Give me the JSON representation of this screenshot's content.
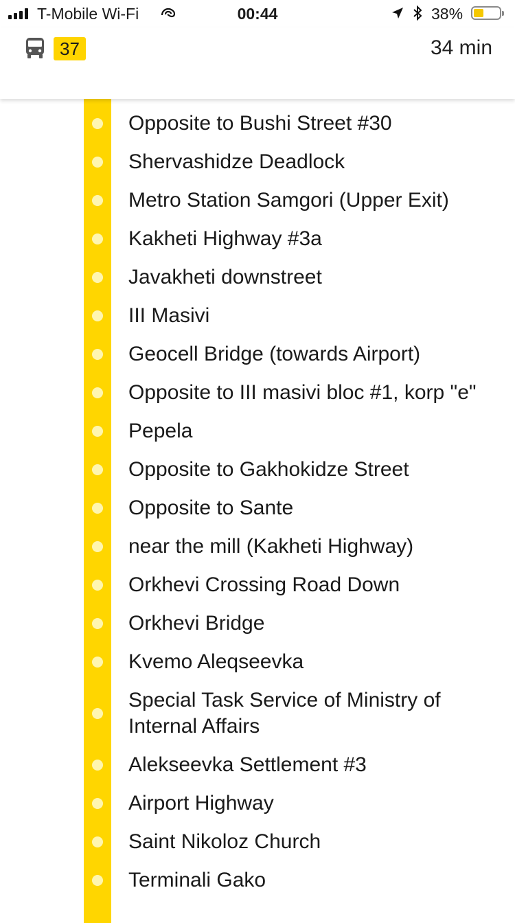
{
  "status_bar": {
    "carrier": "T-Mobile Wi-Fi",
    "time": "00:44",
    "battery_percent": "38%",
    "battery_level": 0.38
  },
  "header": {
    "route_number": "37",
    "duration": "34 min"
  },
  "colors": {
    "route_yellow": "#ffd600",
    "badge_yellow": "#ffd400",
    "battery_yellow": "#f5c800"
  },
  "stops": [
    {
      "name": "Opposite to Bushi Street #30"
    },
    {
      "name": "Shervashidze Deadlock"
    },
    {
      "name": "Metro Station Samgori (Upper Exit)"
    },
    {
      "name": "Kakheti Highway #3a"
    },
    {
      "name": "Javakheti downstreet"
    },
    {
      "name": "III Masivi"
    },
    {
      "name": "Geocell Bridge (towards Airport)"
    },
    {
      "name": "Opposite to III masivi bloc #1, korp \"e\""
    },
    {
      "name": "Pepela"
    },
    {
      "name": "Opposite to Gakhokidze Street"
    },
    {
      "name": "Opposite to Sante"
    },
    {
      "name": "near the mill (Kakheti Highway)"
    },
    {
      "name": "Orkhevi Crossing Road Down"
    },
    {
      "name": "Orkhevi Bridge"
    },
    {
      "name": "Kvemo Aleqseevka"
    },
    {
      "name": "Special Task Service of Ministry of Internal Affairs"
    },
    {
      "name": "Alekseevka Settlement #3"
    },
    {
      "name": "Airport Highway"
    },
    {
      "name": "Saint Nikoloz Church"
    },
    {
      "name": "Terminali Gako"
    }
  ]
}
